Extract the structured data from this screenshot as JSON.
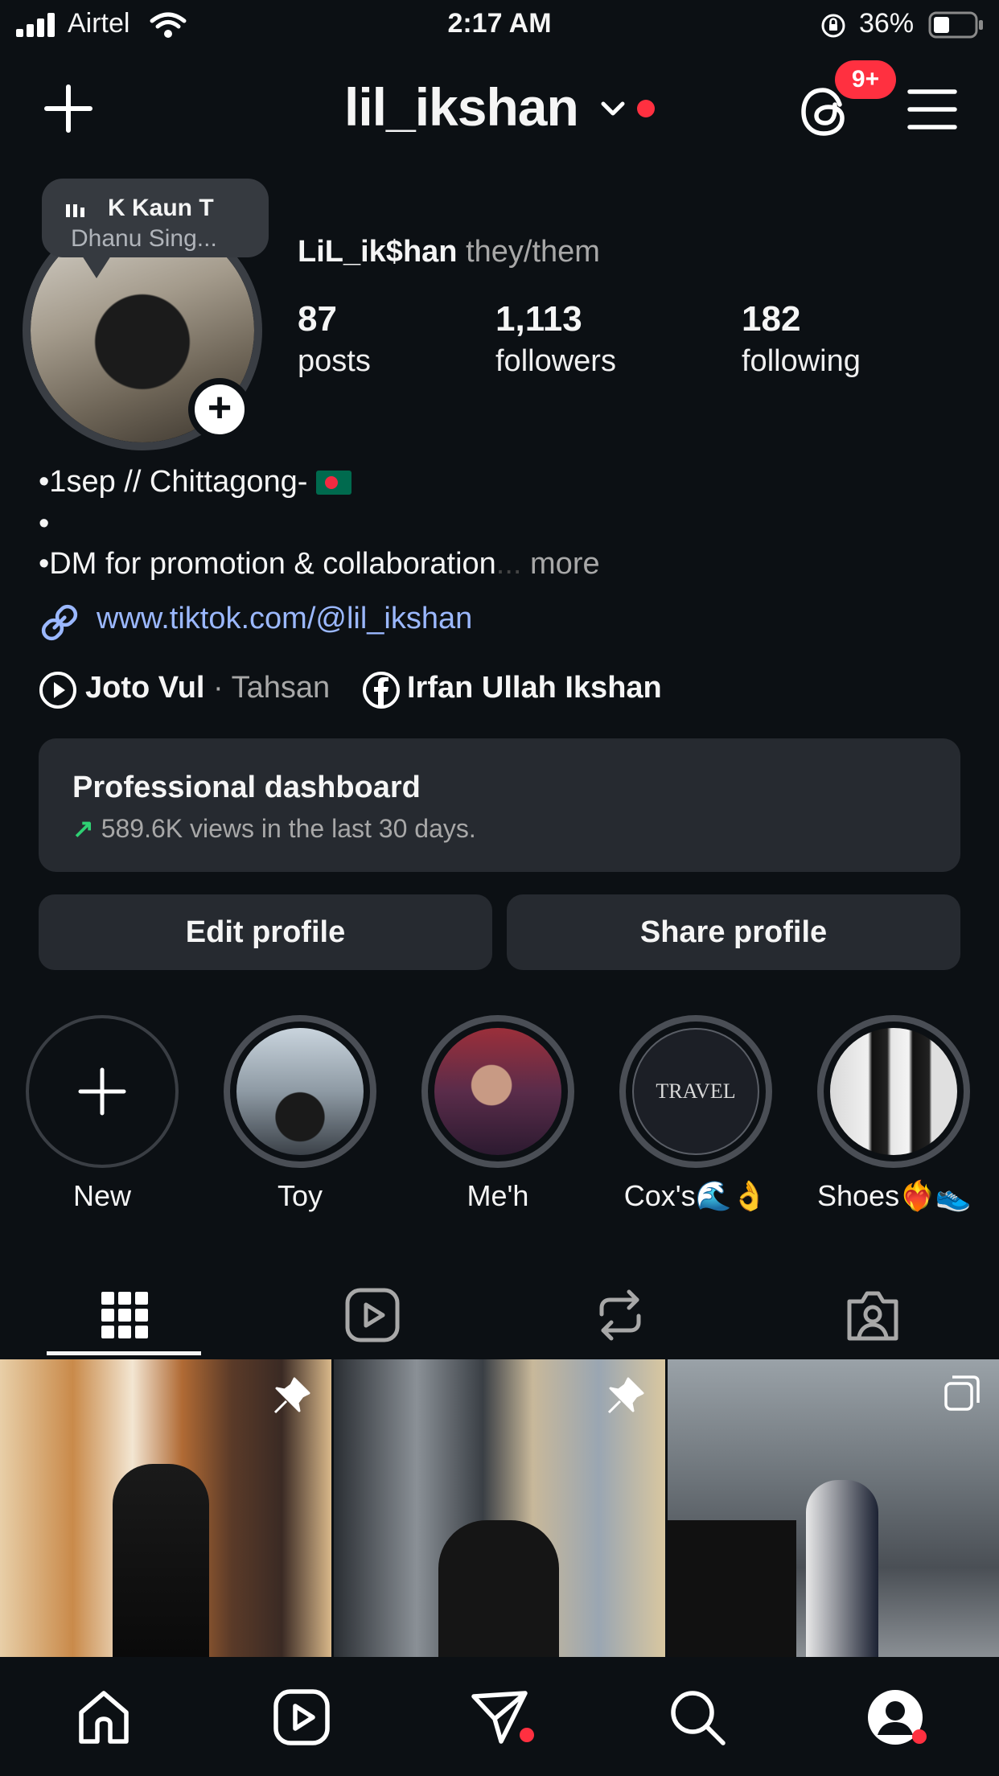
{
  "status_bar": {
    "carrier": "Airtel",
    "time": "2:17 AM",
    "battery": "36%"
  },
  "header": {
    "username": "lil_ikshan",
    "notification_count": "9+"
  },
  "profile": {
    "music": {
      "track": "K  Kaun T",
      "artist": "Dhanu Sing..."
    },
    "display_name": "LiL_ik$han",
    "pronouns": "they/them",
    "stats": [
      {
        "value": "87",
        "label": "posts"
      },
      {
        "value": "1,113",
        "label": "followers"
      },
      {
        "value": "182",
        "label": "following"
      }
    ],
    "bio": [
      "•1sep // Chittagong-",
      "•",
      "•DM for promotion & collaboration"
    ],
    "bio_ellipsis": "...",
    "bio_more": "more",
    "link": "www.tiktok.com/@lil_ikshan",
    "song_title": "Joto Vul",
    "song_separator": "·",
    "song_artist": "Tahsan",
    "facebook_name": "Irfan Ullah Ikshan"
  },
  "dashboard": {
    "title": "Professional dashboard",
    "arrow": "↗",
    "subtitle": "589.6K views in the last 30 days."
  },
  "buttons": {
    "edit": "Edit profile",
    "share": "Share profile"
  },
  "highlights": [
    {
      "label": "New"
    },
    {
      "label": "Toy"
    },
    {
      "label": "Me'h"
    },
    {
      "label": "Cox's🌊👌"
    },
    {
      "label": "Shoes❤️‍🔥👟"
    }
  ],
  "highlight_travel_text": "TRAVEL",
  "colors": {
    "background": "#0c1014",
    "card": "#262a30",
    "link": "#9bb8ff",
    "badge": "#ff3040",
    "trend": "#2fd073"
  },
  "icons": {
    "header": [
      "plus-icon",
      "chevron-down-icon",
      "threads-icon",
      "menu-icon"
    ],
    "tabs": [
      "grid-icon",
      "reels-icon",
      "reposts-icon",
      "tagged-icon"
    ],
    "nav": [
      "home-icon",
      "reels-icon",
      "send-icon",
      "search-icon",
      "profile-avatar-icon"
    ]
  }
}
